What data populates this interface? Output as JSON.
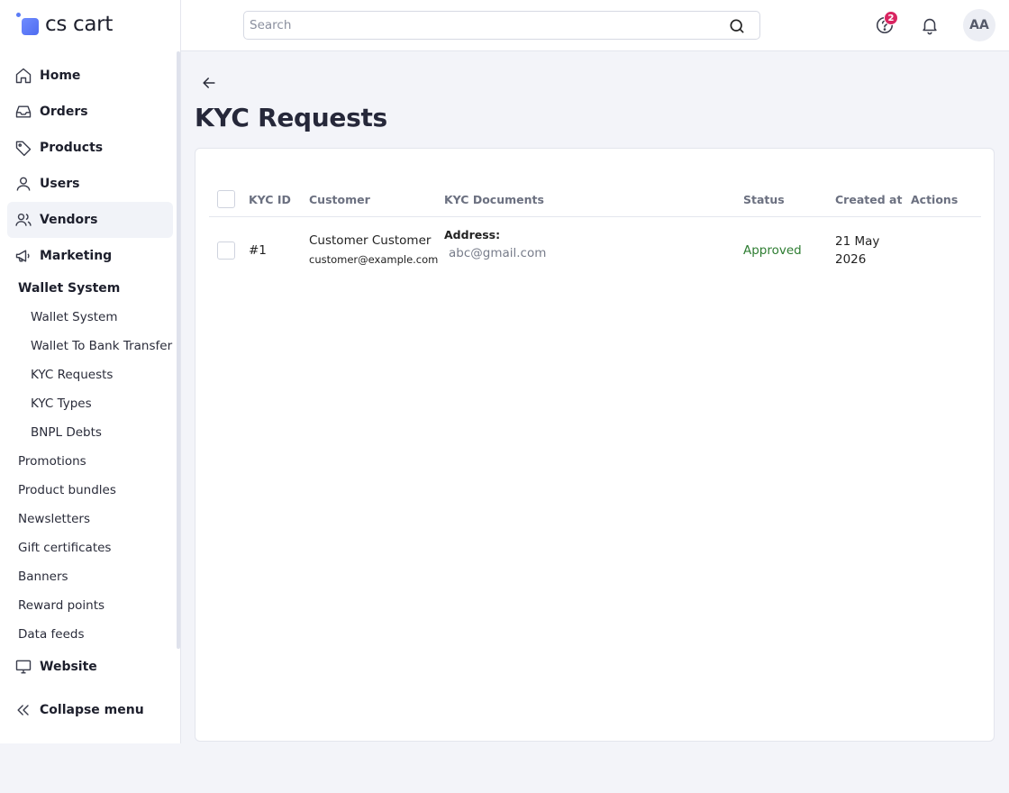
{
  "brand": {
    "name": "cs cart",
    "accent": "#5b7cf6"
  },
  "search": {
    "placeholder": "Search"
  },
  "header": {
    "help_badge": "2",
    "avatar_initials": "AA"
  },
  "sidebar": {
    "items": [
      {
        "label": "Home",
        "icon": "home-icon"
      },
      {
        "label": "Orders",
        "icon": "inbox-icon"
      },
      {
        "label": "Products",
        "icon": "tag-icon"
      },
      {
        "label": "Users",
        "icon": "user-icon"
      },
      {
        "label": "Vendors",
        "icon": "users-icon"
      },
      {
        "label": "Marketing",
        "icon": "megaphone-icon"
      }
    ],
    "wallet_section": "Wallet System",
    "wallet_items": [
      "Wallet System",
      "Wallet To Bank Transfer",
      "KYC Requests",
      "KYC Types",
      "BNPL Debts"
    ],
    "marketing_items": [
      "Promotions",
      "Product bundles",
      "Newsletters",
      "Gift certificates",
      "Banners",
      "Reward points",
      "Data feeds"
    ],
    "website": {
      "label": "Website",
      "icon": "monitor-icon"
    },
    "collapse": {
      "label": "Collapse menu",
      "icon": "chevrons-left-icon"
    }
  },
  "page": {
    "title": "KYC Requests"
  },
  "table": {
    "columns": [
      "KYC ID",
      "Customer",
      "KYC Documents",
      "Status",
      "Created at",
      "Actions"
    ],
    "rows": [
      {
        "id": "#1",
        "customer_name": "Customer Customer",
        "customer_email": "customer@example.com",
        "doc_label": "Address:",
        "doc_value": "abc@gmail.com",
        "status": "Approved",
        "created_line1": "21 May",
        "created_line2": "2026"
      }
    ]
  },
  "colors": {
    "status_approved": "#2e7d32",
    "badge": "#d92561"
  }
}
